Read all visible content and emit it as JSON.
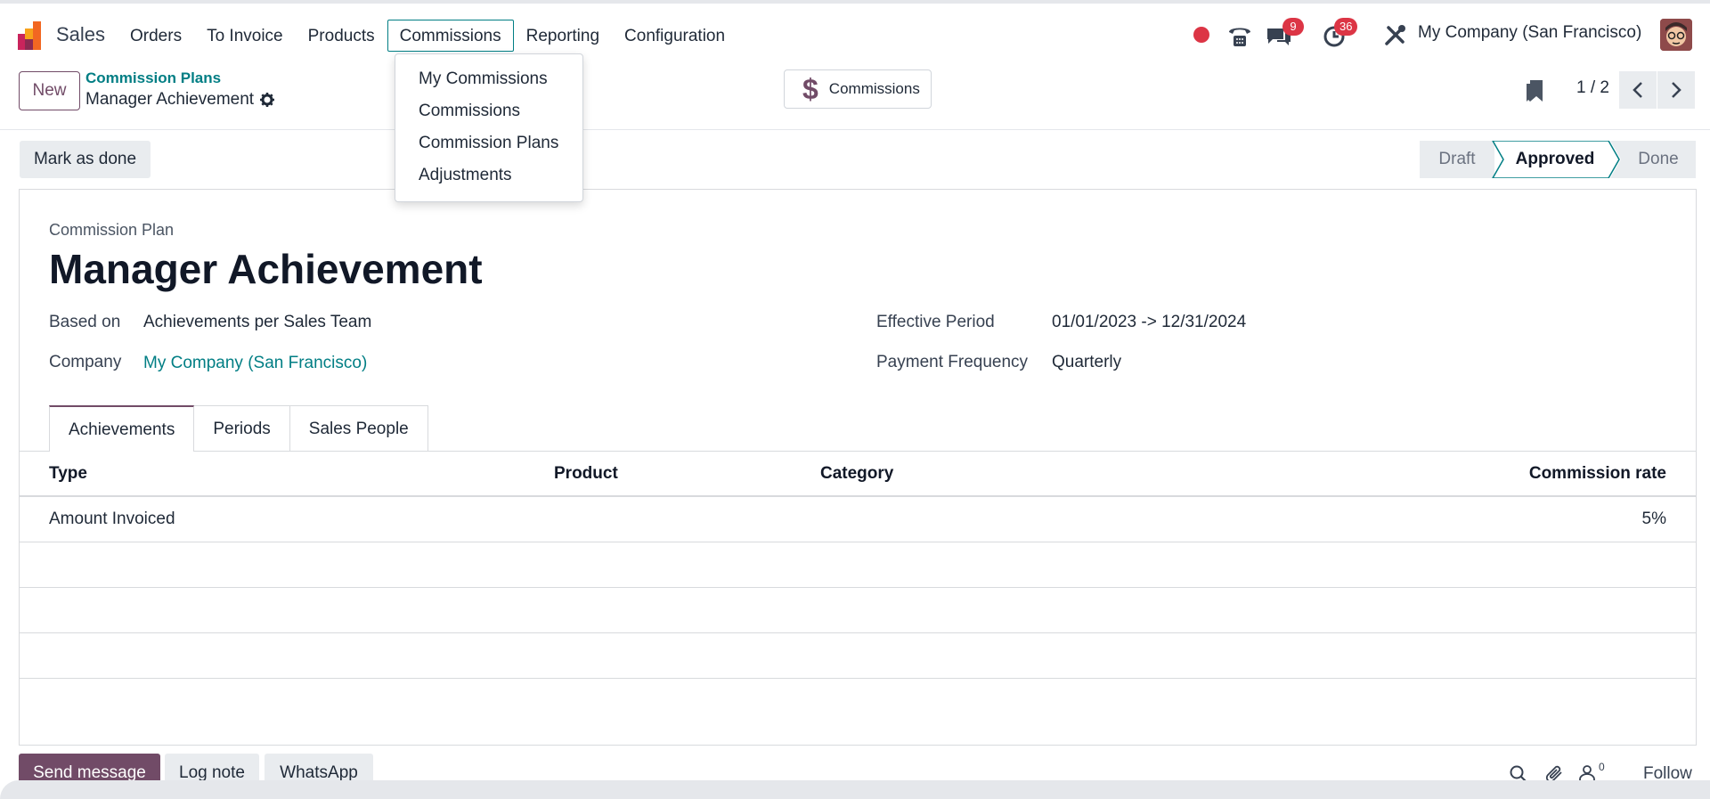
{
  "app": {
    "name": "Sales"
  },
  "menu": {
    "items": [
      "Orders",
      "To Invoice",
      "Products",
      "Commissions",
      "Reporting",
      "Configuration"
    ],
    "active": "Commissions",
    "dropdown": [
      "My Commissions",
      "Commissions",
      "Commission Plans",
      "Adjustments"
    ]
  },
  "systray": {
    "messages_count": "9",
    "activities_count": "36",
    "company": "My Company (San Francisco)"
  },
  "control": {
    "new_label": "New",
    "breadcrumb_parent": "Commission Plans",
    "breadcrumb_current": "Manager Achievement",
    "smart_button_label": "Commissions",
    "pager": "1 / 2"
  },
  "status": {
    "mark_done_label": "Mark as done",
    "stages": [
      "Draft",
      "Approved",
      "Done"
    ],
    "current_stage": "Approved"
  },
  "form": {
    "type_label": "Commission Plan",
    "title": "Manager Achievement",
    "fields": {
      "based_on_label": "Based on",
      "based_on_value": "Achievements per Sales Team",
      "company_label": "Company",
      "company_value": "My Company (San Francisco)",
      "period_label": "Effective Period",
      "period_value": "01/01/2023 -> 12/31/2024",
      "frequency_label": "Payment Frequency",
      "frequency_value": "Quarterly"
    },
    "tabs": [
      "Achievements",
      "Periods",
      "Sales People"
    ],
    "active_tab": "Achievements",
    "table": {
      "headers": [
        "Type",
        "Product",
        "Category",
        "Commission rate"
      ],
      "rows": [
        {
          "type": "Amount Invoiced",
          "product": "",
          "category": "",
          "rate": "5%"
        }
      ]
    }
  },
  "chatter": {
    "send_label": "Send message",
    "log_label": "Log note",
    "whatsapp_label": "WhatsApp",
    "followers_count": "0",
    "follow_label": "Follow"
  },
  "colors": {
    "brand": "#714b67",
    "link": "#017e84",
    "badge": "#dc3545"
  }
}
